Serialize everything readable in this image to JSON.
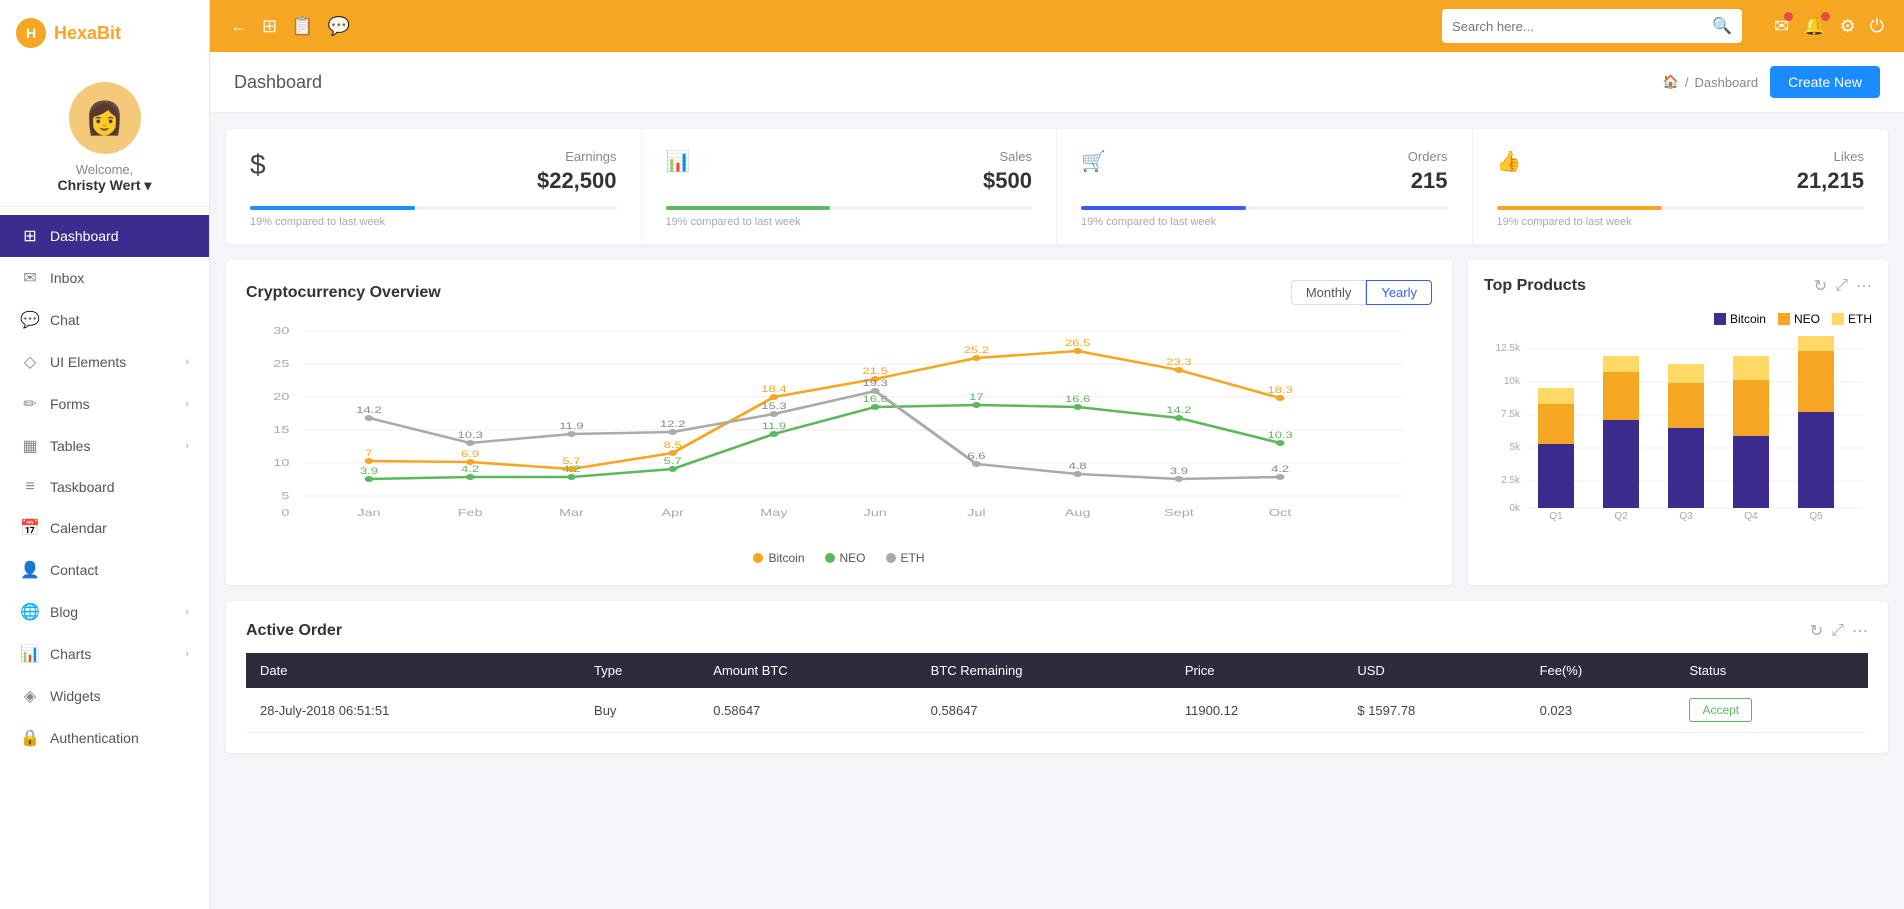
{
  "app": {
    "name": "HexaBit",
    "logo_text": "HexaBit"
  },
  "sidebar": {
    "profile": {
      "welcome": "Welcome,",
      "user": "Christy Wert"
    },
    "nav": [
      {
        "id": "dashboard",
        "label": "Dashboard",
        "icon": "⊞",
        "active": true
      },
      {
        "id": "inbox",
        "label": "Inbox",
        "icon": "✉"
      },
      {
        "id": "chat",
        "label": "Chat",
        "icon": "💬"
      },
      {
        "id": "ui-elements",
        "label": "UI Elements",
        "icon": "◇",
        "has_arrow": true
      },
      {
        "id": "forms",
        "label": "Forms",
        "icon": "✏",
        "has_arrow": true
      },
      {
        "id": "tables",
        "label": "Tables",
        "icon": "▦",
        "has_arrow": true
      },
      {
        "id": "taskboard",
        "label": "Taskboard",
        "icon": "≡"
      },
      {
        "id": "calendar",
        "label": "Calendar",
        "icon": "📅"
      },
      {
        "id": "contact",
        "label": "Contact",
        "icon": "👤"
      },
      {
        "id": "blog",
        "label": "Blog",
        "icon": "🌐",
        "has_arrow": true
      },
      {
        "id": "charts",
        "label": "Charts",
        "icon": "📊",
        "has_arrow": true
      },
      {
        "id": "widgets",
        "label": "Widgets",
        "icon": "◈"
      },
      {
        "id": "authentication",
        "label": "Authentication",
        "icon": "🔒"
      }
    ]
  },
  "topbar": {
    "search_placeholder": "Search here...",
    "nav_icons": [
      "←",
      "⊞",
      "📋",
      "💬"
    ]
  },
  "breadcrumb": {
    "home_icon": "🏠",
    "separator": "/",
    "current": "Dashboard"
  },
  "page_title": "Dashboard",
  "create_button": "Create New",
  "stats": [
    {
      "icon": "$",
      "label": "Earnings",
      "value": "$22,500",
      "footer": "19% compared to last week",
      "progress_color": "blue"
    },
    {
      "icon": "📊",
      "label": "Sales",
      "value": "$500",
      "footer": "19% compared to last week",
      "progress_color": "green"
    },
    {
      "icon": "🛒",
      "label": "Orders",
      "value": "215",
      "footer": "19% compared to last week",
      "progress_color": "darkblue"
    },
    {
      "icon": "👍",
      "label": "Likes",
      "value": "21,215",
      "footer": "19% compared to last week",
      "progress_color": "yellow"
    }
  ],
  "crypto_chart": {
    "title": "Cryptocurrency Overview",
    "period_buttons": [
      "Monthly",
      "Yearly"
    ],
    "active_period": "Yearly",
    "x_labels": [
      "Jan",
      "Feb",
      "Mar",
      "Apr",
      "May",
      "Jun",
      "Jul",
      "Aug",
      "Sept",
      "Oct"
    ],
    "y_labels": [
      "0",
      "5",
      "10",
      "15",
      "20",
      "25",
      "30"
    ],
    "series": {
      "bitcoin": {
        "color": "#f5a623",
        "data": [
          7,
          6.9,
          5.7,
          8.5,
          18.4,
          21.5,
          25.2,
          26.5,
          23.3,
          18.3
        ]
      },
      "neo": {
        "color": "#5cb85c",
        "data": [
          3.9,
          4.2,
          4.2,
          5.7,
          11.9,
          16.6,
          17,
          16.6,
          14.2,
          10.3
        ]
      },
      "eth": {
        "color": "#aaa",
        "data": [
          14.2,
          10.3,
          11.9,
          12.2,
          15.3,
          19.3,
          6.6,
          4.8,
          3.9,
          4.2
        ]
      }
    },
    "legend": [
      "Bitcoin",
      "NEO",
      "ETH"
    ]
  },
  "top_products": {
    "title": "Top Products",
    "legend": [
      {
        "label": "Bitcoin",
        "color": "#3d2c8d"
      },
      {
        "label": "NEO",
        "color": "#f5a623"
      },
      {
        "label": "ETH",
        "color": "#ffd966"
      }
    ],
    "x_labels": [
      "Q1",
      "Q2",
      "Q3",
      "Q4",
      "Q5"
    ],
    "y_labels": [
      "12.5k",
      "10k",
      "7.5k",
      "5k",
      "2.5k",
      "0k"
    ],
    "data": [
      {
        "bitcoin": 40,
        "neo": 25,
        "eth": 10
      },
      {
        "bitcoin": 55,
        "neo": 30,
        "eth": 15
      },
      {
        "bitcoin": 50,
        "neo": 28,
        "eth": 12
      },
      {
        "bitcoin": 45,
        "neo": 35,
        "eth": 18
      },
      {
        "bitcoin": 60,
        "neo": 38,
        "eth": 20
      }
    ]
  },
  "active_order": {
    "title": "Active Order",
    "columns": [
      "Date",
      "Type",
      "Amount BTC",
      "BTC Remaining",
      "Price",
      "USD",
      "Fee(%)",
      "Status"
    ],
    "rows": [
      {
        "date": "28-July-2018 06:51:51",
        "type": "Buy",
        "amount_btc": "0.58647",
        "btc_remaining": "0.58647",
        "price": "11900.12",
        "usd": "$ 1597.78",
        "fee": "0.023",
        "status": "Accept"
      }
    ]
  }
}
